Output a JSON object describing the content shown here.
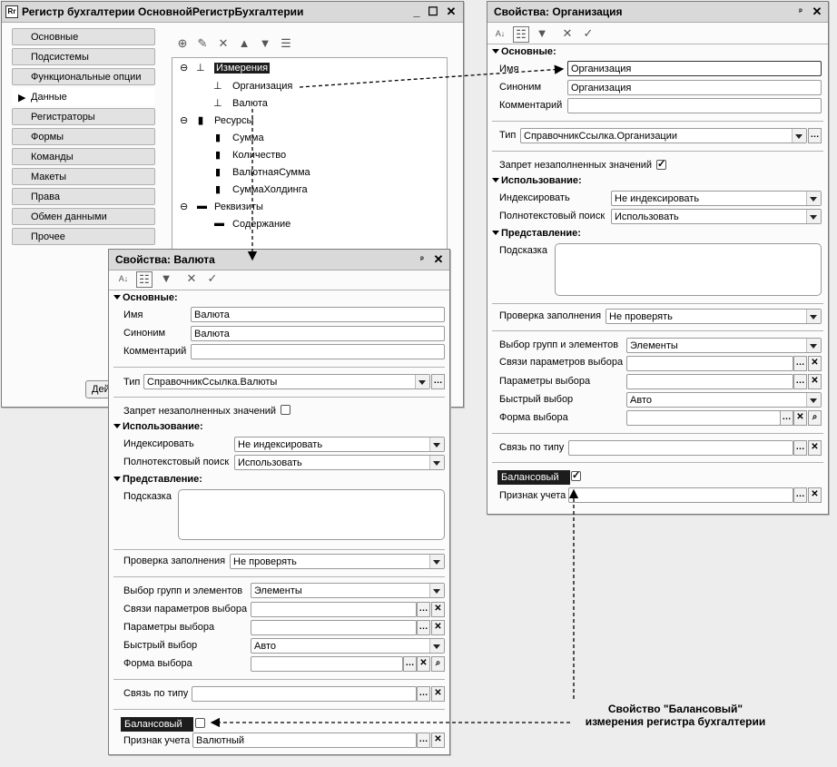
{
  "register_window": {
    "title": "Регистр бухгалтерии ОсновнойРегистрБухгалтерии",
    "nav": [
      "Основные",
      "Подсистемы",
      "Функциональные опции",
      "Данные",
      "Регистраторы",
      "Формы",
      "Команды",
      "Макеты",
      "Права",
      "Обмен данными",
      "Прочее"
    ],
    "active_nav": "Данные",
    "tree": {
      "dimensions": "Измерения",
      "dim_items": [
        "Организация",
        "Валюта"
      ],
      "resources": "Ресурсы",
      "res_items": [
        "Сумма",
        "Количество",
        "ВалютнаяСумма",
        "СуммаХолдинга"
      ],
      "attributes": "Реквизиты",
      "attr_items": [
        "Содержание"
      ]
    },
    "actions_button": "Дей"
  },
  "props_valuta": {
    "title": "Свойства: Валюта",
    "section_main": "Основные:",
    "name_label": "Имя",
    "name_value": "Валюта",
    "synonym_label": "Синоним",
    "synonym_value": "Валюта",
    "comment_label": "Комментарий",
    "comment_value": "",
    "type_label": "Тип",
    "type_value": "СправочникСсылка.Валюты",
    "deny_empty_label": "Запрет незаполненных значений",
    "deny_empty_checked": false,
    "section_usage": "Использование:",
    "index_label": "Индексировать",
    "index_value": "Не индексировать",
    "fulltext_label": "Полнотекстовый поиск",
    "fulltext_value": "Использовать",
    "section_view": "Представление:",
    "hint_label": "Подсказка",
    "fill_check_label": "Проверка заполнения",
    "fill_check_value": "Не проверять",
    "group_choice_label": "Выбор групп и элементов",
    "group_choice_value": "Элементы",
    "param_links_label": "Связи параметров выбора",
    "choice_params_label": "Параметры выбора",
    "quick_choice_label": "Быстрый выбор",
    "quick_choice_value": "Авто",
    "choice_form_label": "Форма выбора",
    "type_link_label": "Связь по типу",
    "balance_label": "Балансовый",
    "balance_checked": false,
    "account_flag_label": "Признак учета",
    "account_flag_value": "Валютный"
  },
  "props_org": {
    "title": "Свойства: Организация",
    "section_main": "Основные:",
    "name_label": "Имя",
    "name_value": "Организация",
    "synonym_label": "Синоним",
    "synonym_value": "Организация",
    "comment_label": "Комментарий",
    "comment_value": "",
    "type_label": "Тип",
    "type_value": "СправочникСсылка.Организации",
    "deny_empty_label": "Запрет незаполненных значений",
    "deny_empty_checked": true,
    "section_usage": "Использование:",
    "index_label": "Индексировать",
    "index_value": "Не индексировать",
    "fulltext_label": "Полнотекстовый поиск",
    "fulltext_value": "Использовать",
    "section_view": "Представление:",
    "hint_label": "Подсказка",
    "fill_check_label": "Проверка заполнения",
    "fill_check_value": "Не проверять",
    "group_choice_label": "Выбор групп и элементов",
    "group_choice_value": "Элементы",
    "param_links_label": "Связи параметров выбора",
    "choice_params_label": "Параметры выбора",
    "quick_choice_label": "Быстрый выбор",
    "quick_choice_value": "Авто",
    "choice_form_label": "Форма выбора",
    "type_link_label": "Связь по типу",
    "balance_label": "Балансовый",
    "balance_checked": true,
    "account_flag_label": "Признак учета",
    "account_flag_value": ""
  },
  "annotation": {
    "line1": "Свойство \"Балансовый\"",
    "line2": "измерения регистра бухгалтерии"
  },
  "icons": [
    "add-icon",
    "edit-icon",
    "delete-icon",
    "move-up-icon",
    "move-down-icon",
    "sort-icon",
    "alpha-sort-icon",
    "categories-icon",
    "filter-icon",
    "cancel-icon",
    "apply-icon",
    "pin-icon",
    "close-icon",
    "minimize-icon",
    "maximize-icon",
    "ellipsis-icon",
    "clear-icon",
    "search-icon",
    "dropdown-icon"
  ]
}
